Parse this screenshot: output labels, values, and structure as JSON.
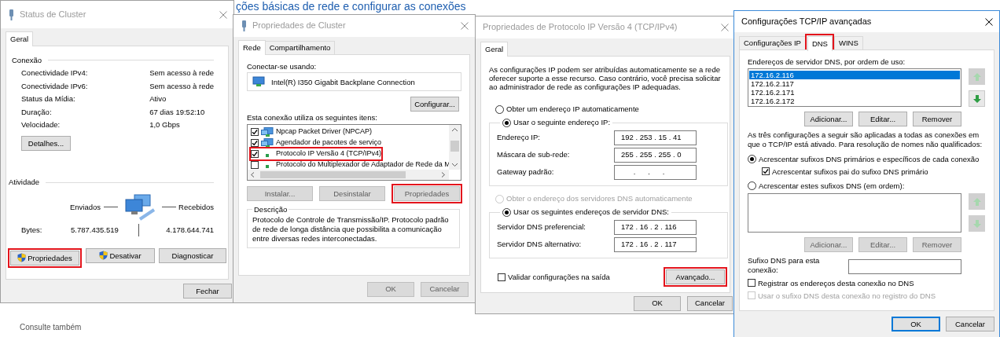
{
  "background": {
    "heading": "ções básicas de rede e configurar as conexões",
    "see_also": "Consulte também"
  },
  "status_window": {
    "title": "Status de Cluster",
    "active": false,
    "tabs": [
      {
        "label": "Geral",
        "selected": true
      }
    ],
    "connection": {
      "heading": "Conexão",
      "rows": [
        {
          "label": "Conectividade IPv4:",
          "value": "Sem acesso à rede"
        },
        {
          "label": "Conectividade IPv6:",
          "value": "Sem acesso à rede"
        },
        {
          "label": "Status da Mídia:",
          "value": "Ativo"
        },
        {
          "label": "Duração:",
          "value": "67 dias 19:52:10"
        },
        {
          "label": "Velocidade:",
          "value": "1,0 Gbps"
        }
      ]
    },
    "details_button": "Detalhes...",
    "activity": {
      "heading": "Atividade",
      "sent": "Enviados",
      "received": "Recebidos",
      "bytes_label": "Bytes:",
      "bytes_sent": "5.787.435.519",
      "bytes_received": "4.178.644.741"
    },
    "buttons": [
      {
        "label": "Propriedades",
        "shield": true,
        "highlighted": true
      },
      {
        "label": "Desativar",
        "shield": true,
        "highlighted": false
      },
      {
        "label": "Diagnosticar",
        "shield": false,
        "highlighted": false
      }
    ],
    "close_button": "Fechar"
  },
  "properties_window": {
    "title": "Propriedades de Cluster",
    "active": false,
    "tabs": [
      {
        "label": "Rede",
        "selected": true
      },
      {
        "label": "Compartilhamento",
        "selected": false
      }
    ],
    "connect_label": "Conectar-se usando:",
    "adapter": "Intel(R) I350 Gigabit Backplane Connection",
    "configure_button": "Configurar...",
    "items_label": "Esta conexão utiliza os seguintes itens:",
    "items": [
      {
        "label": "Npcap Packet Driver (NPCAP)",
        "checked": true,
        "kind": "service",
        "highlighted": false
      },
      {
        "label": "Agendador de pacotes de serviço",
        "checked": true,
        "kind": "service",
        "highlighted": false
      },
      {
        "label": "Protocolo IP Versão 4 (TCP/IPv4)",
        "checked": true,
        "kind": "protocol",
        "highlighted": true
      },
      {
        "label": "Protocolo do Multiplexador de Adaptador de Rede da M",
        "checked": false,
        "kind": "protocol",
        "highlighted": false
      }
    ],
    "buttons": [
      {
        "label": "Instalar...",
        "disabled": true,
        "highlighted": false
      },
      {
        "label": "Desinstalar",
        "disabled": true,
        "highlighted": false
      },
      {
        "label": "Propriedades",
        "disabled": true,
        "highlighted": true
      }
    ],
    "description": {
      "heading": "Descrição",
      "text": "Protocolo de Controle de Transmissão/IP. Protocolo padrão de rede de longa distância que possibilita a comunicação entre diversas redes interconectadas."
    },
    "footer_buttons": [
      {
        "label": "OK",
        "disabled": true
      },
      {
        "label": "Cancelar",
        "disabled": true
      }
    ]
  },
  "ipv4_window": {
    "title": "Propriedades de Protocolo IP Versão 4 (TCP/IPv4)",
    "active": false,
    "tabs": [
      {
        "label": "Geral",
        "selected": true
      }
    ],
    "intro": "As configurações IP podem ser atribuídas automaticamente se a rede oferecer suporte a esse recurso. Caso contrário, você precisa solicitar ao administrador de rede as configurações IP adequadas.",
    "ip_options": [
      {
        "label": "Obter um endereço IP automaticamente",
        "selected": false,
        "disabled": false
      },
      {
        "label": "Usar o seguinte endereço IP:",
        "selected": true,
        "disabled": false
      }
    ],
    "ip_fields": [
      {
        "label": "Endereço IP:",
        "value": "192 . 253 . 15 . 41"
      },
      {
        "label": "Máscara de sub-rede:",
        "value": "255 . 255 . 255 . 0"
      },
      {
        "label": "Gateway padrão:",
        "value": "      .      .      ."
      }
    ],
    "dns_options": [
      {
        "label": "Obter o endereço dos servidores DNS automaticamente",
        "selected": false,
        "disabled": true
      },
      {
        "label": "Usar os seguintes endereços de servidor DNS:",
        "selected": true,
        "disabled": false
      }
    ],
    "dns_fields": [
      {
        "label": "Servidor DNS preferencial:",
        "value": "172 . 16 . 2 . 116"
      },
      {
        "label": "Servidor DNS alternativo:",
        "value": "172 . 16 . 2 . 117"
      }
    ],
    "validate": {
      "label": "Validar configurações na saída",
      "checked": false
    },
    "advanced_button": {
      "label": "Avançado...",
      "highlighted": true
    },
    "footer_buttons": [
      {
        "label": "OK"
      },
      {
        "label": "Cancelar"
      }
    ]
  },
  "advanced_window": {
    "title": "Configurações TCP/IP avançadas",
    "active": true,
    "tabs": [
      {
        "label": "Configurações IP",
        "selected": false,
        "highlighted": false
      },
      {
        "label": "DNS",
        "selected": true,
        "highlighted": true
      },
      {
        "label": "WINS",
        "selected": false,
        "highlighted": false
      }
    ],
    "servers_label": "Endereços de servidor DNS, por ordem de uso:",
    "dns_servers": [
      {
        "address": "172.16.2.116",
        "selected": true
      },
      {
        "address": "172.16.2.117",
        "selected": false
      },
      {
        "address": "172.16.2.171",
        "selected": false
      },
      {
        "address": "172.16.2.172",
        "selected": false
      }
    ],
    "server_order_buttons": [
      {
        "kind": "up",
        "disabled": true
      },
      {
        "kind": "down",
        "disabled": false
      }
    ],
    "server_buttons": [
      {
        "label": "Adicionar...",
        "disabled": false
      },
      {
        "label": "Editar...",
        "disabled": false
      },
      {
        "label": "Remover",
        "disabled": false
      }
    ],
    "explanation": "As três configurações a seguir são aplicadas a todas as conexões em que o TCP/IP está ativado. Para resolução de nomes não qualificados:",
    "suffix_options": [
      {
        "kind": "radio",
        "label": "Acrescentar sufixos DNS primários e específicos de cada conexão",
        "selected": true,
        "children": [
          {
            "kind": "checkbox",
            "label": "Acrescentar sufixos pai do sufixo DNS primário",
            "checked": true
          }
        ]
      },
      {
        "kind": "radio",
        "label": "Acrescentar estes sufixos DNS (em ordem):",
        "selected": false
      }
    ],
    "suffix_order_buttons": [
      {
        "kind": "up",
        "disabled": true
      },
      {
        "kind": "down",
        "disabled": true
      }
    ],
    "suffix_buttons": [
      {
        "label": "Adicionar...",
        "disabled": true
      },
      {
        "label": "Editar...",
        "disabled": true
      },
      {
        "label": "Remover",
        "disabled": true
      }
    ],
    "suffix_field": {
      "label": "Sufixo DNS para esta conexão:"
    },
    "register_options": [
      {
        "label": "Registrar os endereços desta conexão no DNS",
        "checked": false,
        "disabled": false
      },
      {
        "label": "Usar o sufixo DNS desta conexão no registro do DNS",
        "checked": false,
        "disabled": true
      }
    ],
    "footer_buttons": [
      {
        "label": "OK",
        "default": true
      },
      {
        "label": "Cancelar",
        "default": false
      }
    ]
  }
}
